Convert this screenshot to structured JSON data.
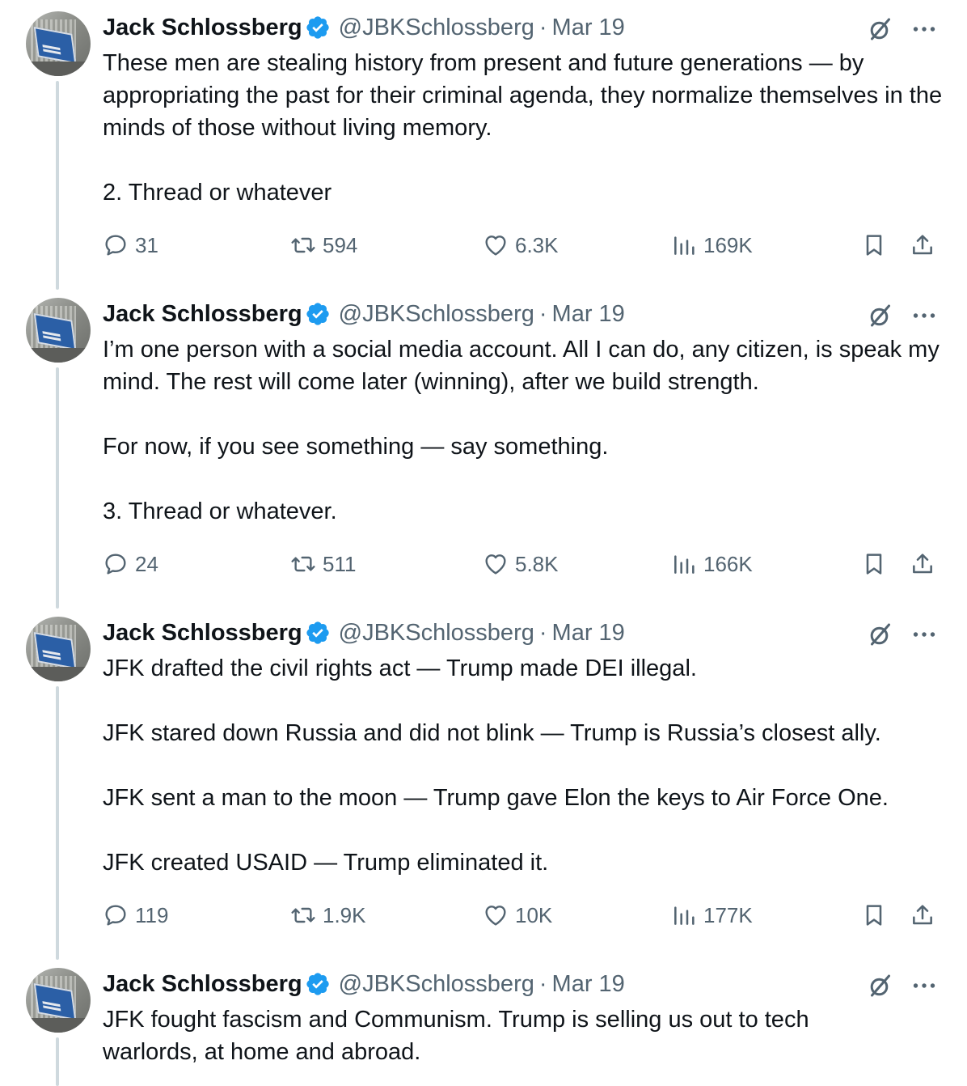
{
  "author": {
    "name": "Jack Schlossberg",
    "handle": "@JBKSchlossberg"
  },
  "separator": "·",
  "colors": {
    "text": "#0f1419",
    "secondary": "#536471",
    "verified": "#1d9bf0",
    "thread_line": "#cfd9de"
  },
  "icons": {
    "verified": "verified-badge-icon",
    "grok": "grok-icon",
    "more": "more-options-icon",
    "reply": "reply-icon",
    "repost": "repost-icon",
    "like": "like-heart-icon",
    "views": "views-icon",
    "bookmark": "bookmark-icon",
    "share": "share-icon"
  },
  "tweets": [
    {
      "date": "Mar 19",
      "paragraphs": [
        "These men are stealing history from present and future generations — by appropriating the past for their criminal agenda, they normalize themselves in the minds of those without living memory.",
        "2. Thread or whatever"
      ],
      "stats": {
        "replies": "31",
        "reposts": "594",
        "likes": "6.3K",
        "views": "169K"
      }
    },
    {
      "date": "Mar 19",
      "paragraphs": [
        "I’m one person with a social media account. All I can do, any citizen, is speak my mind. The rest will come later (winning), after we build strength.",
        "For now, if you see something — say something.",
        "3. Thread or whatever."
      ],
      "stats": {
        "replies": "24",
        "reposts": "511",
        "likes": "5.8K",
        "views": "166K"
      }
    },
    {
      "date": "Mar 19",
      "paragraphs": [
        "JFK drafted the civil rights act — Trump made DEI illegal.",
        "JFK stared down Russia and did not blink — Trump is Russia’s closest ally.",
        "JFK sent a man to the moon — Trump gave Elon the keys to Air Force One.",
        "JFK created USAID — Trump eliminated it."
      ],
      "stats": {
        "replies": "119",
        "reposts": "1.9K",
        "likes": "10K",
        "views": "177K"
      }
    },
    {
      "date": "Mar 19",
      "paragraphs": [
        "JFK fought fascism and Communism. Trump is selling us out to tech warlords, at home and abroad."
      ],
      "stats": null
    }
  ]
}
